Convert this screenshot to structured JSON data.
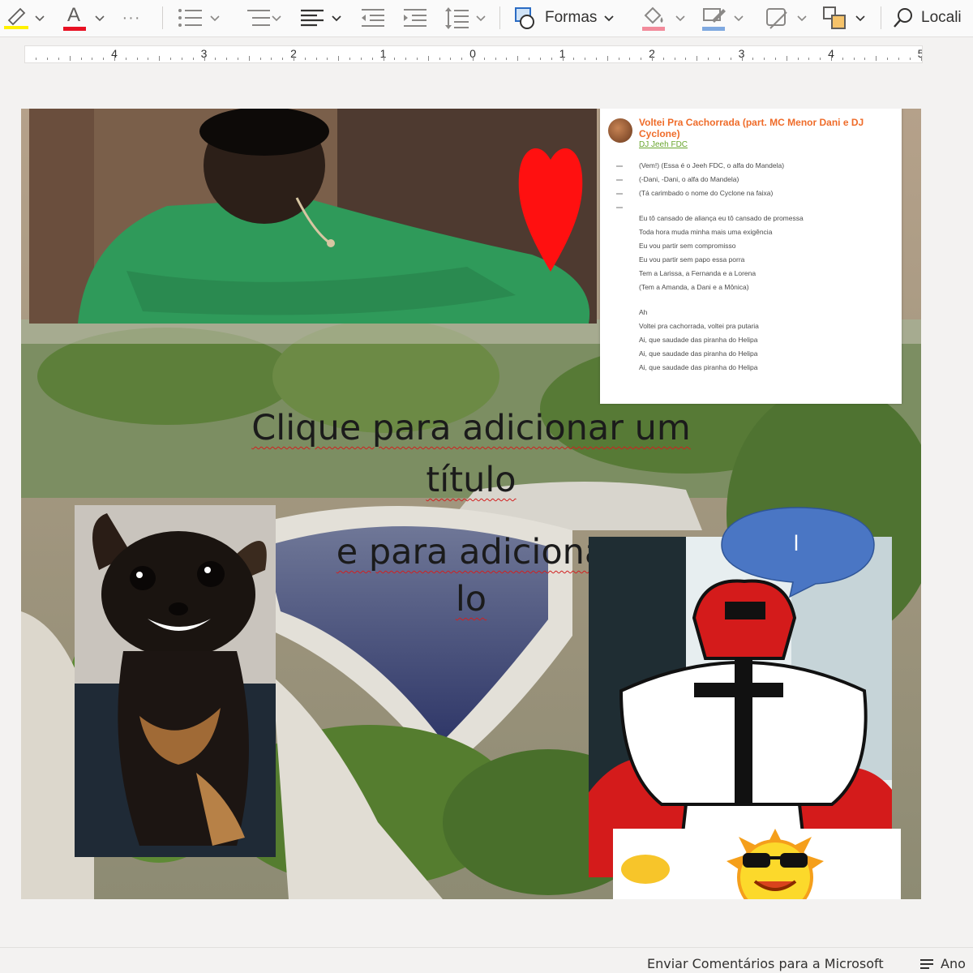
{
  "toolbar": {
    "shapes_label": "Formas",
    "find_label": "Locali",
    "more_label": "···",
    "font_color_glyph": "A"
  },
  "ruler": {
    "numbers": [
      "4",
      "3",
      "2",
      "1",
      "0",
      "1",
      "2",
      "3",
      "4",
      "5"
    ]
  },
  "slide": {
    "lyrics": {
      "song_title": "Voltei Pra Cachorrada (part. MC Menor Dani e DJ Cyclone)",
      "artist": "DJ Jeeh FDC",
      "lines": [
        "(Vem!) (Essa é o Jeeh FDC, o alfa do Mandela)",
        "(-Dani, -Dani, o alfa do Mandela)",
        "(Tá carimbado o nome do Cyclone na faixa)",
        "",
        "Eu tô cansado de aliança eu tô cansado de promessa",
        "Toda hora muda minha mais uma exigência",
        "Eu vou partir sem compromisso",
        "Eu vou partir sem papo essa porra",
        "Tem a Larissa, a Fernanda e a Lorena",
        "(Tem a Amanda, a Dani e a Mônica)",
        "",
        "Ah",
        "Voltei pra cachorrada, voltei pra putaria",
        "Ai, que saudade das piranha do Helipa",
        "Ai, que saudade das piranha do Helipa",
        "Ai, que saudade das piranha do Helipa"
      ]
    },
    "title_placeholder": {
      "line1": "Clique para adicionar um",
      "line2": "título"
    },
    "subtitle_placeholder": {
      "line1": "e para adiciona",
      "line2": "lo"
    },
    "speech_bubble_text": "l"
  },
  "statusbar": {
    "feedback": "Enviar Comentários para a Microsoft",
    "notes": "Ano"
  },
  "colors": {
    "heart": "#ff1010",
    "bubble": "#4a76c4",
    "shirt": "#2f9a5a",
    "lyrics_title": "#ef6c2a",
    "artist_link": "#6aa62f",
    "spell_underline": "#d21f1f"
  }
}
